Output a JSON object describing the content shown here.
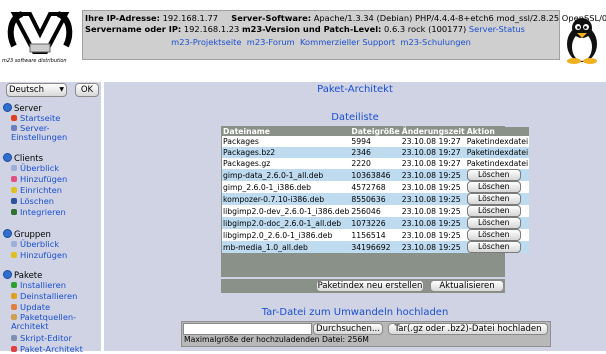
{
  "header": {
    "logo_caption": "m23 software distribution",
    "line1": {
      "ip_label": "Ihre IP-Adresse:",
      "ip_value": "192.168.1.77",
      "software_label": "Server-Software:",
      "software_value": "Apache/1.3.34 (Debian) PHP/4.4.4-8+etch6 mod_ssl/2.8.25 OpenSSL/0.9.8c"
    },
    "line2": {
      "server_label": "Servername oder IP:",
      "server_value": "192.168.1.23",
      "version_label": "m23-Version und Patch-Level:",
      "version_value": "0.6.3 rock (100177)",
      "status_link": "Server-Status"
    },
    "links": [
      "m23-Projektseite",
      "m23-Forum",
      "Kommerzieller Support",
      "m23-Schulungen"
    ]
  },
  "sidebar": {
    "language": "Deutsch",
    "ok_label": "OK",
    "sections": [
      {
        "title": "Server",
        "items": [
          "Startseite",
          "Server-Einstellungen"
        ]
      },
      {
        "title": "Clients",
        "items": [
          "Überblick",
          "Hinzufügen",
          "Einrichten",
          "Löschen",
          "Integrieren"
        ]
      },
      {
        "title": "Gruppen",
        "items": [
          "Überblick",
          "Hinzufügen"
        ]
      },
      {
        "title": "Pakete",
        "items": [
          "Installieren",
          "Deinstallieren",
          "Update",
          "Paketquellen-Architekt",
          "Skript-Editor",
          "Paket-Architekt"
        ]
      }
    ]
  },
  "main": {
    "title": "Paket-Architekt",
    "filelist_title": "Dateiliste",
    "columns": [
      "Dateiname",
      "Dateigröße",
      "Änderungszeit",
      "Aktion"
    ],
    "rows": [
      {
        "name": "Packages",
        "size": "5994",
        "time": "23.10.08 19:27",
        "action": "Paketindexdatei"
      },
      {
        "name": "Packages.bz2",
        "size": "2346",
        "time": "23.10.08 19:27",
        "action": "Paketindexdatei"
      },
      {
        "name": "Packages.gz",
        "size": "2220",
        "time": "23.10.08 19:27",
        "action": "Paketindexdatei"
      },
      {
        "name": "gimp-data_2.6.0-1_all.deb",
        "size": "10363846",
        "time": "23.10.08 19:25",
        "action": "Löschen"
      },
      {
        "name": "gimp_2.6.0-1_i386.deb",
        "size": "4572768",
        "time": "23.10.08 19:25",
        "action": "Löschen"
      },
      {
        "name": "kompozer-0.7.10-i386.deb",
        "size": "8550636",
        "time": "23.10.08 19:25",
        "action": "Löschen"
      },
      {
        "name": "libgimp2.0-dev_2.6.0-1_i386.deb",
        "size": "256046",
        "time": "23.10.08 19:25",
        "action": "Löschen"
      },
      {
        "name": "libgimp2.0-doc_2.6.0-1_all.deb",
        "size": "1073226",
        "time": "23.10.08 19:25",
        "action": "Löschen"
      },
      {
        "name": "libgimp2.0_2.6.0-1_i386.deb",
        "size": "1156514",
        "time": "23.10.08 19:25",
        "action": "Löschen"
      },
      {
        "name": "mb-media_1.0_all.deb",
        "size": "34196692",
        "time": "23.10.08 19:25",
        "action": "Löschen"
      }
    ],
    "reindex_label": "Paketindex neu erstellen",
    "refresh_label": "Aktualisieren",
    "upload_title": "Tar-Datei zum Umwandeln hochladen",
    "browse_label": "Durchsuchen...",
    "upload_label": "Tar(.gz oder .bz2)-Datei hochladen",
    "max_size_note": "Maximalgröße der hochzuladenden Datei: 256M"
  },
  "colors": {
    "accent": "#1a4fcf",
    "panel": "#cfd3e4",
    "table_header": "#8a9188",
    "row_alt": "#bfdbf0"
  },
  "icons": [
    "m23-logo-icon",
    "tux-penguin-icon",
    "section-bullet-icon",
    "home-icon",
    "server-settings-icon"
  ]
}
